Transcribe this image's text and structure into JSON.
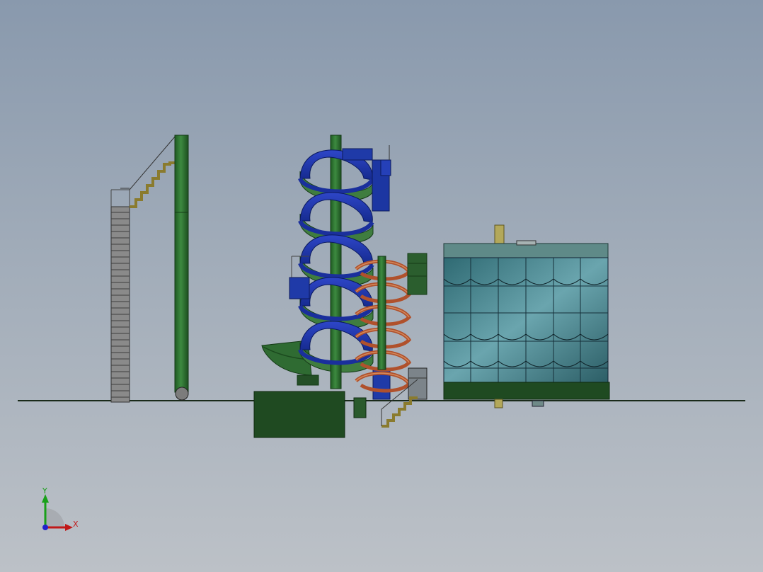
{
  "viewport": {
    "background_top": "#8999ad",
    "background_bottom": "#bcc1c7"
  },
  "model": {
    "objects": [
      "ground-line",
      "left-tower",
      "left-stairs",
      "green-pipe",
      "central-spiral-slide",
      "orange-spiral-slide",
      "splash-bowl",
      "lower-stairs",
      "building-right"
    ]
  },
  "triad": {
    "x_label": "X",
    "y_label": "Y",
    "x_color": "#c01818",
    "y_color": "#19a019",
    "z_color": "#2222cc"
  }
}
